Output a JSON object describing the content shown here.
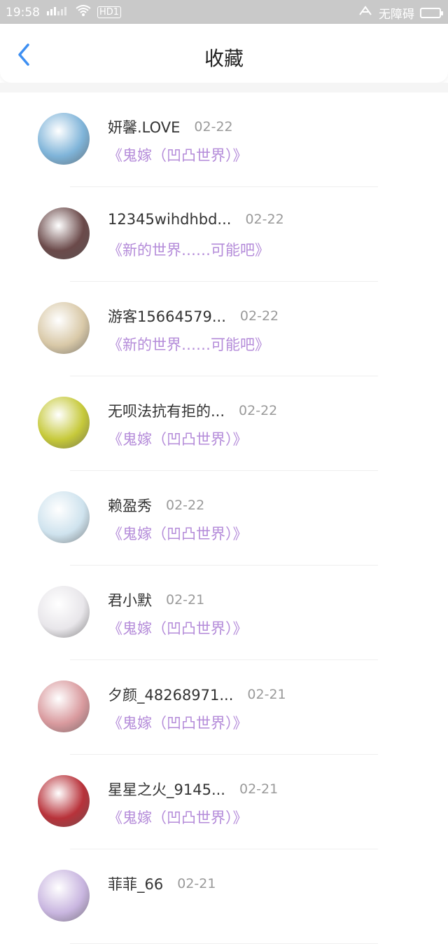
{
  "status_bar": {
    "time": "19:58",
    "network_label": "HD1",
    "accessibility_text": "无障碍",
    "icons": [
      "signal-icon",
      "wifi-icon",
      "hd-icon",
      "accessibility-icon",
      "battery-icon"
    ]
  },
  "header": {
    "title": "收藏",
    "back_icon": "chevron-left-icon",
    "accent_color": "#3d8ff2"
  },
  "colors": {
    "book_title": "#b48bd9",
    "date": "#9a9a9a"
  },
  "favorites": [
    {
      "name": "妍馨.LOVE",
      "date": "02-22",
      "book": "《鬼嫁（凹凸世界）》",
      "avatar_color": "#7fb4d9"
    },
    {
      "name": "12345wihdhbd...",
      "date": "02-22",
      "book": "《新的世界……可能吧》",
      "avatar_color": "#6b4a4a"
    },
    {
      "name": "游客15664579...",
      "date": "02-22",
      "book": "《新的世界……可能吧》",
      "avatar_color": "#d9c9a8"
    },
    {
      "name": "无呗法抗有拒的...",
      "date": "02-22",
      "book": "《鬼嫁（凹凸世界）》",
      "avatar_color": "#c6c93a"
    },
    {
      "name": "赖盈秀",
      "date": "02-22",
      "book": "《鬼嫁（凹凸世界）》",
      "avatar_color": "#cfe3ee"
    },
    {
      "name": "君小默",
      "date": "02-21",
      "book": "《鬼嫁（凹凸世界）》",
      "avatar_color": "#e8e6ea"
    },
    {
      "name": "夕颜_48268971...",
      "date": "02-21",
      "book": "《鬼嫁（凹凸世界）》",
      "avatar_color": "#d99a9e"
    },
    {
      "name": "星星之火_9145...",
      "date": "02-21",
      "book": "《鬼嫁（凹凸世界）》",
      "avatar_color": "#b8323a"
    },
    {
      "name": "菲菲_66",
      "date": "02-21",
      "book": "",
      "avatar_color": "#c9b6e0"
    }
  ]
}
